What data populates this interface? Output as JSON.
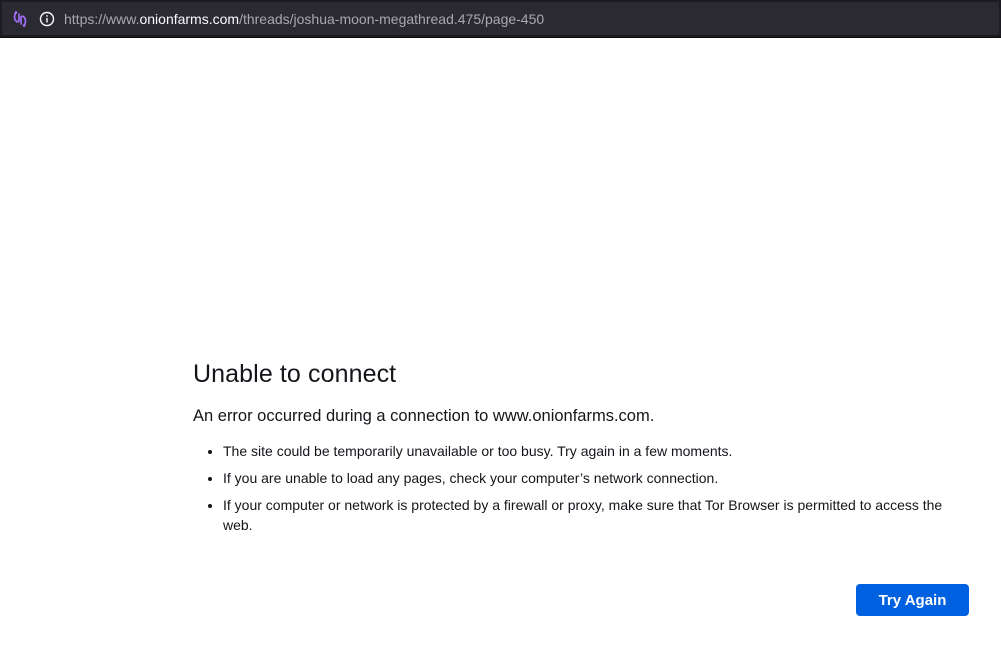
{
  "browser": {
    "url_prefix": "https://www.",
    "url_domain": "onionfarms.com",
    "url_path": "/threads/joshua-moon-megathread.475/page-450",
    "icons": {
      "identity": "tor-onion-circuit-icon",
      "site_info": "info-icon"
    }
  },
  "error_page": {
    "title": "Unable to connect",
    "description": "An error occurred during a connection to www.onionfarms.com.",
    "reasons": [
      "The site could be temporarily unavailable or too busy. Try again in a few moments.",
      "If you are unable to load any pages, check your computer’s network connection.",
      "If your computer or network is protected by a firewall or proxy, make sure that Tor Browser is permitted to access the web."
    ],
    "button_label": "Try Again"
  },
  "colors": {
    "urlbar_bg": "#1c1b22",
    "accent": "#0061e0",
    "text": "#15141a"
  }
}
